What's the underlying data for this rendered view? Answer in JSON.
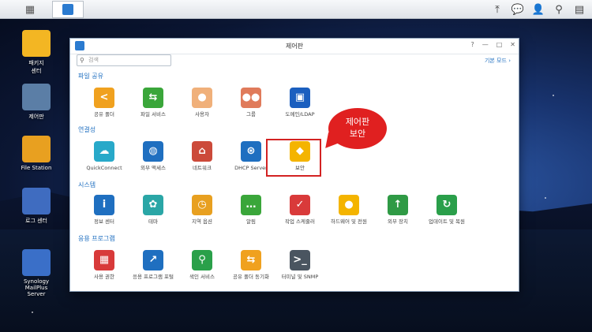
{
  "desktop": [
    {
      "label": "패키지\n센터",
      "icon": "package-center-icon"
    },
    {
      "label": "제어판",
      "icon": "control-panel-icon"
    },
    {
      "label": "File Station",
      "icon": "folder-icon"
    },
    {
      "label": "로그 센터",
      "icon": "log-center-icon"
    },
    {
      "label": "Synology MailPlus Server",
      "icon": "mail-icon"
    }
  ],
  "window": {
    "title": "제어판",
    "search_placeholder": "검색",
    "basic_mode": "기본 모드",
    "controls": [
      "?",
      "—",
      "□",
      "✕"
    ]
  },
  "sections": [
    {
      "title": "파일 공유",
      "items": [
        {
          "label": "공유 폴더",
          "icon": "share-icon",
          "color": "#f0a11f",
          "glyph": "<"
        },
        {
          "label": "파일 서비스",
          "icon": "file-services-icon",
          "color": "#3aa63a",
          "glyph": "⇆"
        },
        {
          "label": "사용자",
          "icon": "user-icon",
          "color": "#f0b07a",
          "glyph": "●"
        },
        {
          "label": "그룹",
          "icon": "group-icon",
          "color": "#e07b5b",
          "glyph": "●●"
        },
        {
          "label": "도메인/LDAP",
          "icon": "ldap-icon",
          "color": "#1b5fbf",
          "glyph": "▣"
        }
      ]
    },
    {
      "title": "연결성",
      "items": [
        {
          "label": "QuickConnect",
          "icon": "quickconnect-icon",
          "color": "#28a9c9",
          "glyph": "☁"
        },
        {
          "label": "외부 액세스",
          "icon": "external-access-icon",
          "color": "#1f6fc0",
          "glyph": "◍"
        },
        {
          "label": "네트워크",
          "icon": "network-icon",
          "color": "#cc4a3a",
          "glyph": "⌂"
        },
        {
          "label": "DHCP Server",
          "icon": "dhcp-icon",
          "color": "#1f6fc0",
          "glyph": "⊛"
        },
        {
          "label": "보안",
          "icon": "shield-icon",
          "color": "#f4b400",
          "glyph": "◆"
        }
      ]
    },
    {
      "title": "시스템",
      "items": [
        {
          "label": "정보 센터",
          "icon": "info-icon",
          "color": "#1f6fc0",
          "glyph": "i"
        },
        {
          "label": "테마",
          "icon": "palette-icon",
          "color": "#2aa6a6",
          "glyph": "✿"
        },
        {
          "label": "지역 옵션",
          "icon": "regional-options-icon",
          "color": "#e8a020",
          "glyph": "◷"
        },
        {
          "label": "알림",
          "icon": "notification-icon",
          "color": "#3aa63a",
          "glyph": "…"
        },
        {
          "label": "작업 스케줄러",
          "icon": "task-scheduler-icon",
          "color": "#d93a3a",
          "glyph": "✓"
        },
        {
          "label": "하드웨어 및 전원",
          "icon": "hardware-power-icon",
          "color": "#f4b400",
          "glyph": "●"
        },
        {
          "label": "외부 장치",
          "icon": "external-devices-icon",
          "color": "#2f9a45",
          "glyph": "↑"
        },
        {
          "label": "업데이트 및 복원",
          "icon": "update-restore-icon",
          "color": "#2a9f4a",
          "glyph": "↻"
        }
      ]
    },
    {
      "title": "응용 프로그램",
      "items": [
        {
          "label": "사용 권한",
          "icon": "privileges-icon",
          "color": "#d83a3a",
          "glyph": "▦"
        },
        {
          "label": "응용 프로그램 포털",
          "icon": "application-portal-icon",
          "color": "#1f6fc0",
          "glyph": "↗"
        },
        {
          "label": "색인 서비스",
          "icon": "indexing-service-icon",
          "color": "#2aa04a",
          "glyph": "⚲"
        },
        {
          "label": "공유 폴더 동기화",
          "icon": "shared-folder-sync-icon",
          "color": "#f0a11f",
          "glyph": "⇆"
        },
        {
          "label": "터미널 및 SNMP",
          "icon": "terminal-icon",
          "color": "#4a5560",
          "glyph": ">_"
        }
      ]
    }
  ],
  "callout": {
    "line1": "제어판",
    "line2": "보안",
    "color": "#e02020"
  }
}
